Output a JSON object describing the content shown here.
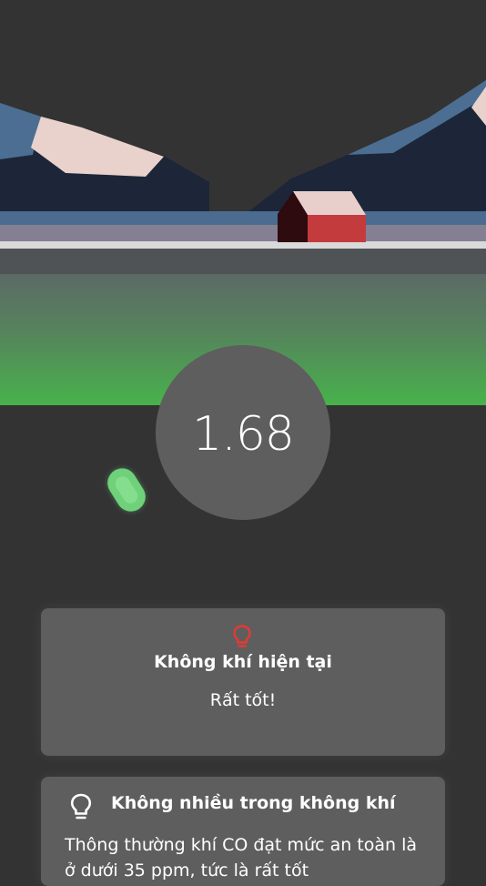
{
  "reading": {
    "value": "1.68"
  },
  "colors": {
    "background": "#333333",
    "card": "#5e5e5e",
    "reading_circle": "#5e5e5e",
    "accent_green": "#4caf50",
    "warning_red": "#e53935"
  },
  "status_card": {
    "icon": "lightbulb-icon",
    "title": "Không khí hiện tại",
    "value": "Rất tốt!"
  },
  "tip_card": {
    "icon": "lightbulb-icon",
    "title": "Không nhiều trong không khí",
    "body": "Thông thường khí CO đạt mức an toàn là ở dưới 35 ppm, tức là rất tốt"
  }
}
